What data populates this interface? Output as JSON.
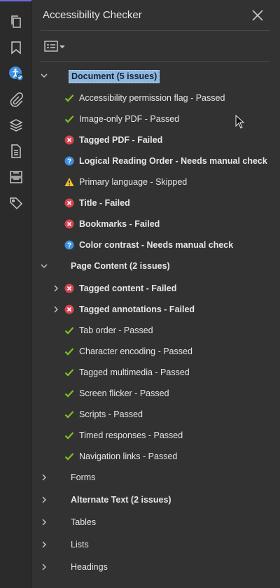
{
  "panel": {
    "title": "Accessibility Checker",
    "close_icon": "close-icon",
    "options_icon": "options-menu-icon"
  },
  "rail": [
    {
      "id": "pages",
      "icon": "pages-icon"
    },
    {
      "id": "bookmarks",
      "icon": "bookmark-icon"
    },
    {
      "id": "accessibility",
      "icon": "accessibility-check-icon",
      "active": true
    },
    {
      "id": "attachments",
      "icon": "paperclip-icon"
    },
    {
      "id": "layers",
      "icon": "layers-icon"
    },
    {
      "id": "content",
      "icon": "document-icon"
    },
    {
      "id": "order",
      "icon": "order-icon"
    },
    {
      "id": "tags",
      "icon": "tag-icon"
    }
  ],
  "colors": {
    "pass": "#7ec31f",
    "fail": "#d9434f",
    "info": "#3e8fe0",
    "warn": "#f2c12e",
    "selection": "#8fb6dd"
  },
  "tree": {
    "document": {
      "label": "Document (5 issues)",
      "items": [
        {
          "label": "Accessibility permission flag - Passed",
          "status": "pass"
        },
        {
          "label": "Image-only PDF - Passed",
          "status": "pass"
        },
        {
          "label": "Tagged PDF - Failed",
          "status": "fail"
        },
        {
          "label": "Logical Reading Order - Needs manual check",
          "status": "info"
        },
        {
          "label": "Primary language - Skipped",
          "status": "warn"
        },
        {
          "label": "Title - Failed",
          "status": "fail"
        },
        {
          "label": "Bookmarks - Failed",
          "status": "fail"
        },
        {
          "label": "Color contrast - Needs manual check",
          "status": "info"
        }
      ]
    },
    "page_content": {
      "label": "Page Content (2 issues)",
      "items": [
        {
          "label": "Tagged content - Failed",
          "status": "fail",
          "expandable": true
        },
        {
          "label": "Tagged annotations - Failed",
          "status": "fail",
          "expandable": true
        },
        {
          "label": "Tab order - Passed",
          "status": "pass"
        },
        {
          "label": "Character encoding - Passed",
          "status": "pass"
        },
        {
          "label": "Tagged multimedia - Passed",
          "status": "pass"
        },
        {
          "label": "Screen flicker - Passed",
          "status": "pass"
        },
        {
          "label": "Scripts - Passed",
          "status": "pass"
        },
        {
          "label": "Timed responses - Passed",
          "status": "pass"
        },
        {
          "label": "Navigation links - Passed",
          "status": "pass"
        }
      ]
    },
    "collapsed_sections": [
      {
        "label": "Forms"
      },
      {
        "label": "Alternate Text (2 issues)"
      },
      {
        "label": "Tables"
      },
      {
        "label": "Lists"
      },
      {
        "label": "Headings"
      }
    ]
  }
}
